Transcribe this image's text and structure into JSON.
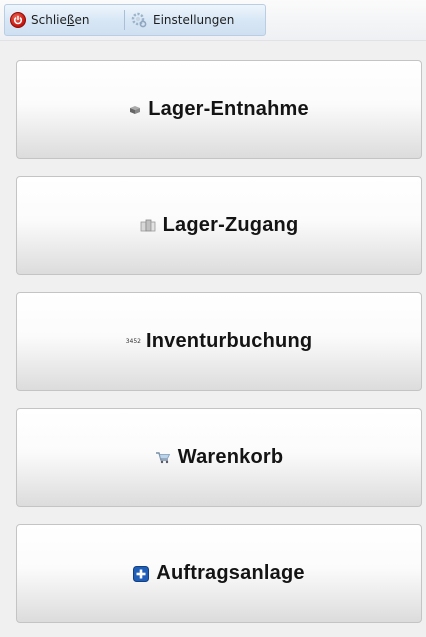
{
  "toolbar": {
    "close_label_pre": "Schlie",
    "close_label_u": "ß",
    "close_label_post": "en",
    "settings_label": "Einstellungen"
  },
  "buttons": [
    {
      "label": "Lager-Entnahme",
      "icon": "box-out-icon"
    },
    {
      "label": "Lager-Zugang",
      "icon": "boxes-in-icon"
    },
    {
      "label": "Inventurbuchung",
      "icon": "counter-icon",
      "icon_text": "3452"
    },
    {
      "label": "Warenkorb",
      "icon": "cart-icon"
    },
    {
      "label": "Auftragsanlage",
      "icon": "plus-icon"
    }
  ],
  "colors": {
    "accent": "#d6e6f5",
    "close_red": "#c3120c",
    "plus_blue": "#1f5fb8"
  }
}
